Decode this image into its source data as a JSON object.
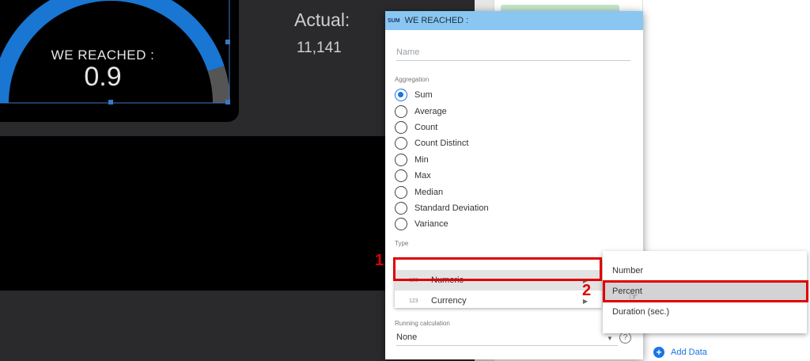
{
  "dashboard": {
    "gauge_label": "WE REACHED :",
    "gauge_value": "0.9",
    "actual_label": "Actual:",
    "actual_value": "11,141",
    "gauge_level": 0.9,
    "colors": {
      "gauge_fill": "#1976d2",
      "gauge_track": "#555555",
      "canvas": "#2a2a2c"
    }
  },
  "dialog": {
    "badge": "SUM",
    "title": "WE REACHED :",
    "name_placeholder": "Name",
    "aggregation_label": "Aggregation",
    "aggregation_options": [
      "Sum",
      "Average",
      "Count",
      "Count Distinct",
      "Min",
      "Max",
      "Median",
      "Standard Deviation",
      "Variance"
    ],
    "selected_aggregation": "Sum",
    "type_label": "Type",
    "type_options": [
      {
        "icon": "123",
        "label": "Numeric"
      },
      {
        "icon": "123",
        "label": "Currency"
      }
    ],
    "running_label": "Running calculation",
    "running_value": "None",
    "help_glyph": "?"
  },
  "submenu": {
    "options": [
      "Number",
      "Percent",
      "Duration (sec.)"
    ],
    "hovered": "Percent"
  },
  "annotations": {
    "step1": "1",
    "step2": "2",
    "color": "#e00000"
  },
  "side_panel": {
    "add_data_label": "Add Data",
    "add_icon": "+"
  }
}
